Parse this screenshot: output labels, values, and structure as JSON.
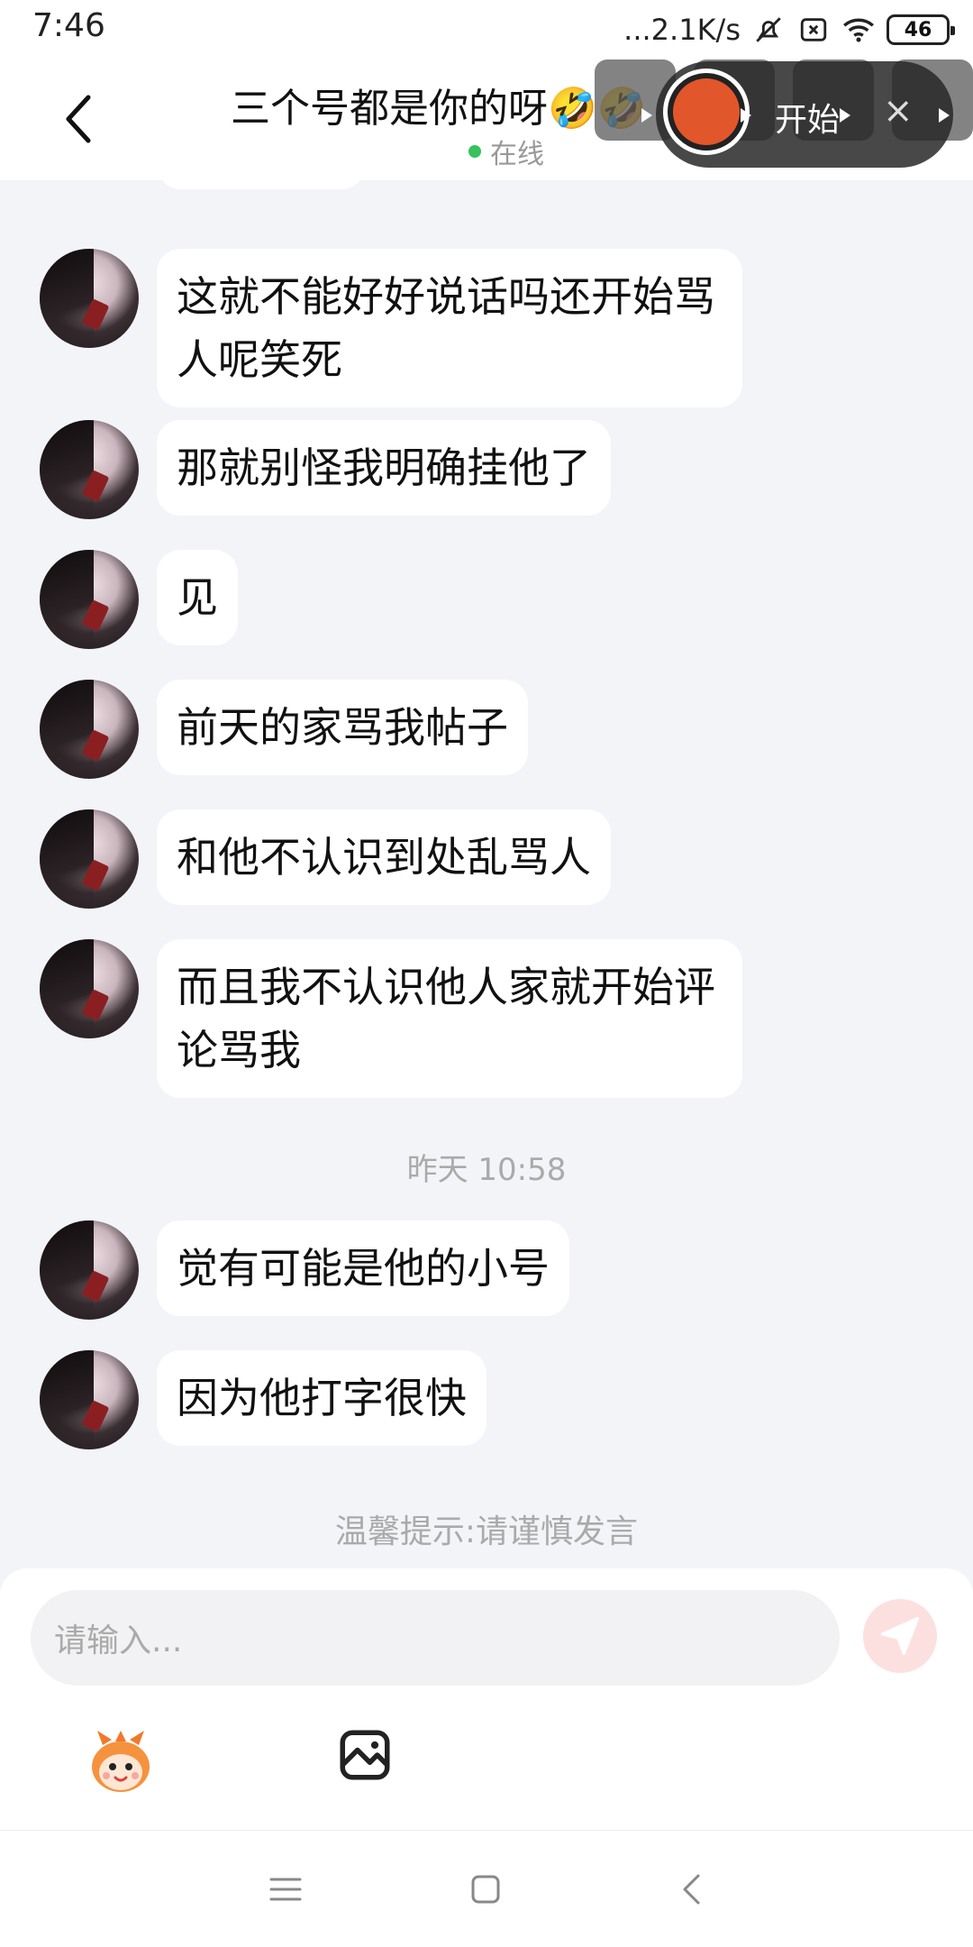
{
  "status_bar": {
    "time": "7:46",
    "network_speed": "...2.1K/s",
    "battery": "46",
    "icons": [
      "mute-bell-icon",
      "no-sim-icon",
      "wifi-icon",
      "battery-icon"
    ]
  },
  "header": {
    "title": "三个号都是你的呀🤣🤣",
    "status": "在线",
    "status_color": "#37c25b"
  },
  "recorder_overlay": {
    "start_label": "开始",
    "close_label": "×"
  },
  "messages": [
    {
      "text": "这就不能好好说话吗还开始骂人呢笑死"
    },
    {
      "text": "那就别怪我明确挂他了"
    },
    {
      "text": "见"
    },
    {
      "text": "前天的家骂我帖子"
    },
    {
      "text": "和他不认识到处乱骂人"
    },
    {
      "text": "而且我不认识他人家就开始评论骂我"
    },
    {
      "text": "觉有可能是他的小号"
    },
    {
      "text": "因为他打字很快"
    }
  ],
  "timestamp": "昨天 10:58",
  "tip": "温馨提示:请谨慎发言",
  "composer": {
    "placeholder": "请输入...",
    "send_color": "#fce0e0"
  },
  "navbar": {
    "icons": [
      "menu-icon",
      "home-icon",
      "back-icon"
    ]
  }
}
